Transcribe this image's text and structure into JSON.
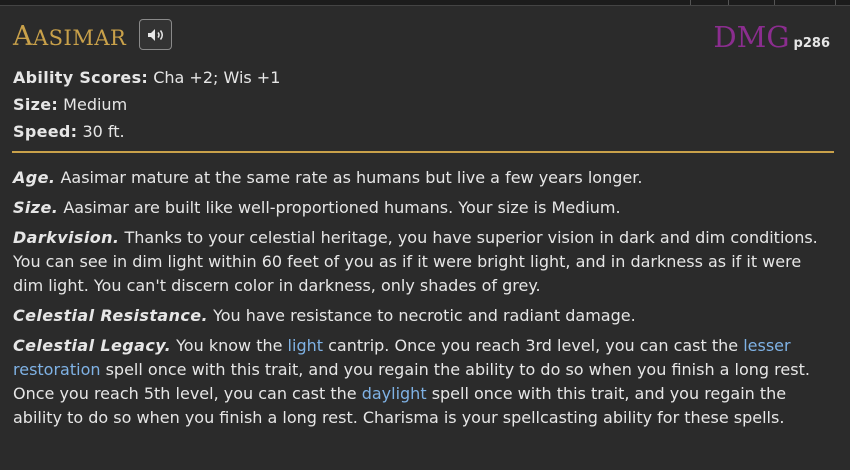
{
  "header": {
    "title_initial": "A",
    "title_rest": "ASIMAR",
    "source_book": "DMG",
    "source_page": "p286"
  },
  "stats": [
    {
      "label": "Ability Scores:",
      "value": "Cha +2; Wis +1"
    },
    {
      "label": "Size:",
      "value": "Medium"
    },
    {
      "label": "Speed:",
      "value": "30 ft."
    }
  ],
  "traits": {
    "age": {
      "name": "Age.",
      "text": "Aasimar mature at the same rate as humans but live a few years longer."
    },
    "size": {
      "name": "Size.",
      "text": "Aasimar are built like well-proportioned humans. Your size is Medium."
    },
    "darkvision": {
      "name": "Darkvision.",
      "text": "Thanks to your celestial heritage, you have superior vision in dark and dim conditions. You can see in dim light within 60 feet of you as if it were bright light, and in darkness as if it were dim light. You can't discern color in darkness, only shades of grey."
    },
    "resistance": {
      "name": "Celestial Resistance.",
      "text": "You have resistance to necrotic and radiant damage."
    },
    "legacy": {
      "name": "Celestial Legacy.",
      "t1": "You know the",
      "spell1": "light",
      "t2": "cantrip. Once you reach 3rd level, you can cast the",
      "spell2": "lesser restoration",
      "t3": "spell once with this trait, and you regain the ability to do so when you finish a long rest. Once you reach 5th level, you can cast the",
      "spell3": "daylight",
      "t4": "spell once with this trait, and you regain the ability to do so when you finish a long rest. Charisma is your spellcasting ability for these spells."
    }
  },
  "icons": {
    "sound_button": "speaker-icon"
  },
  "colors": {
    "title": "#c9a14a",
    "source_book": "#8b2d8f",
    "spell_link": "#7fb2e5",
    "rule": "#c9a14a",
    "background": "#2b2b2b"
  }
}
